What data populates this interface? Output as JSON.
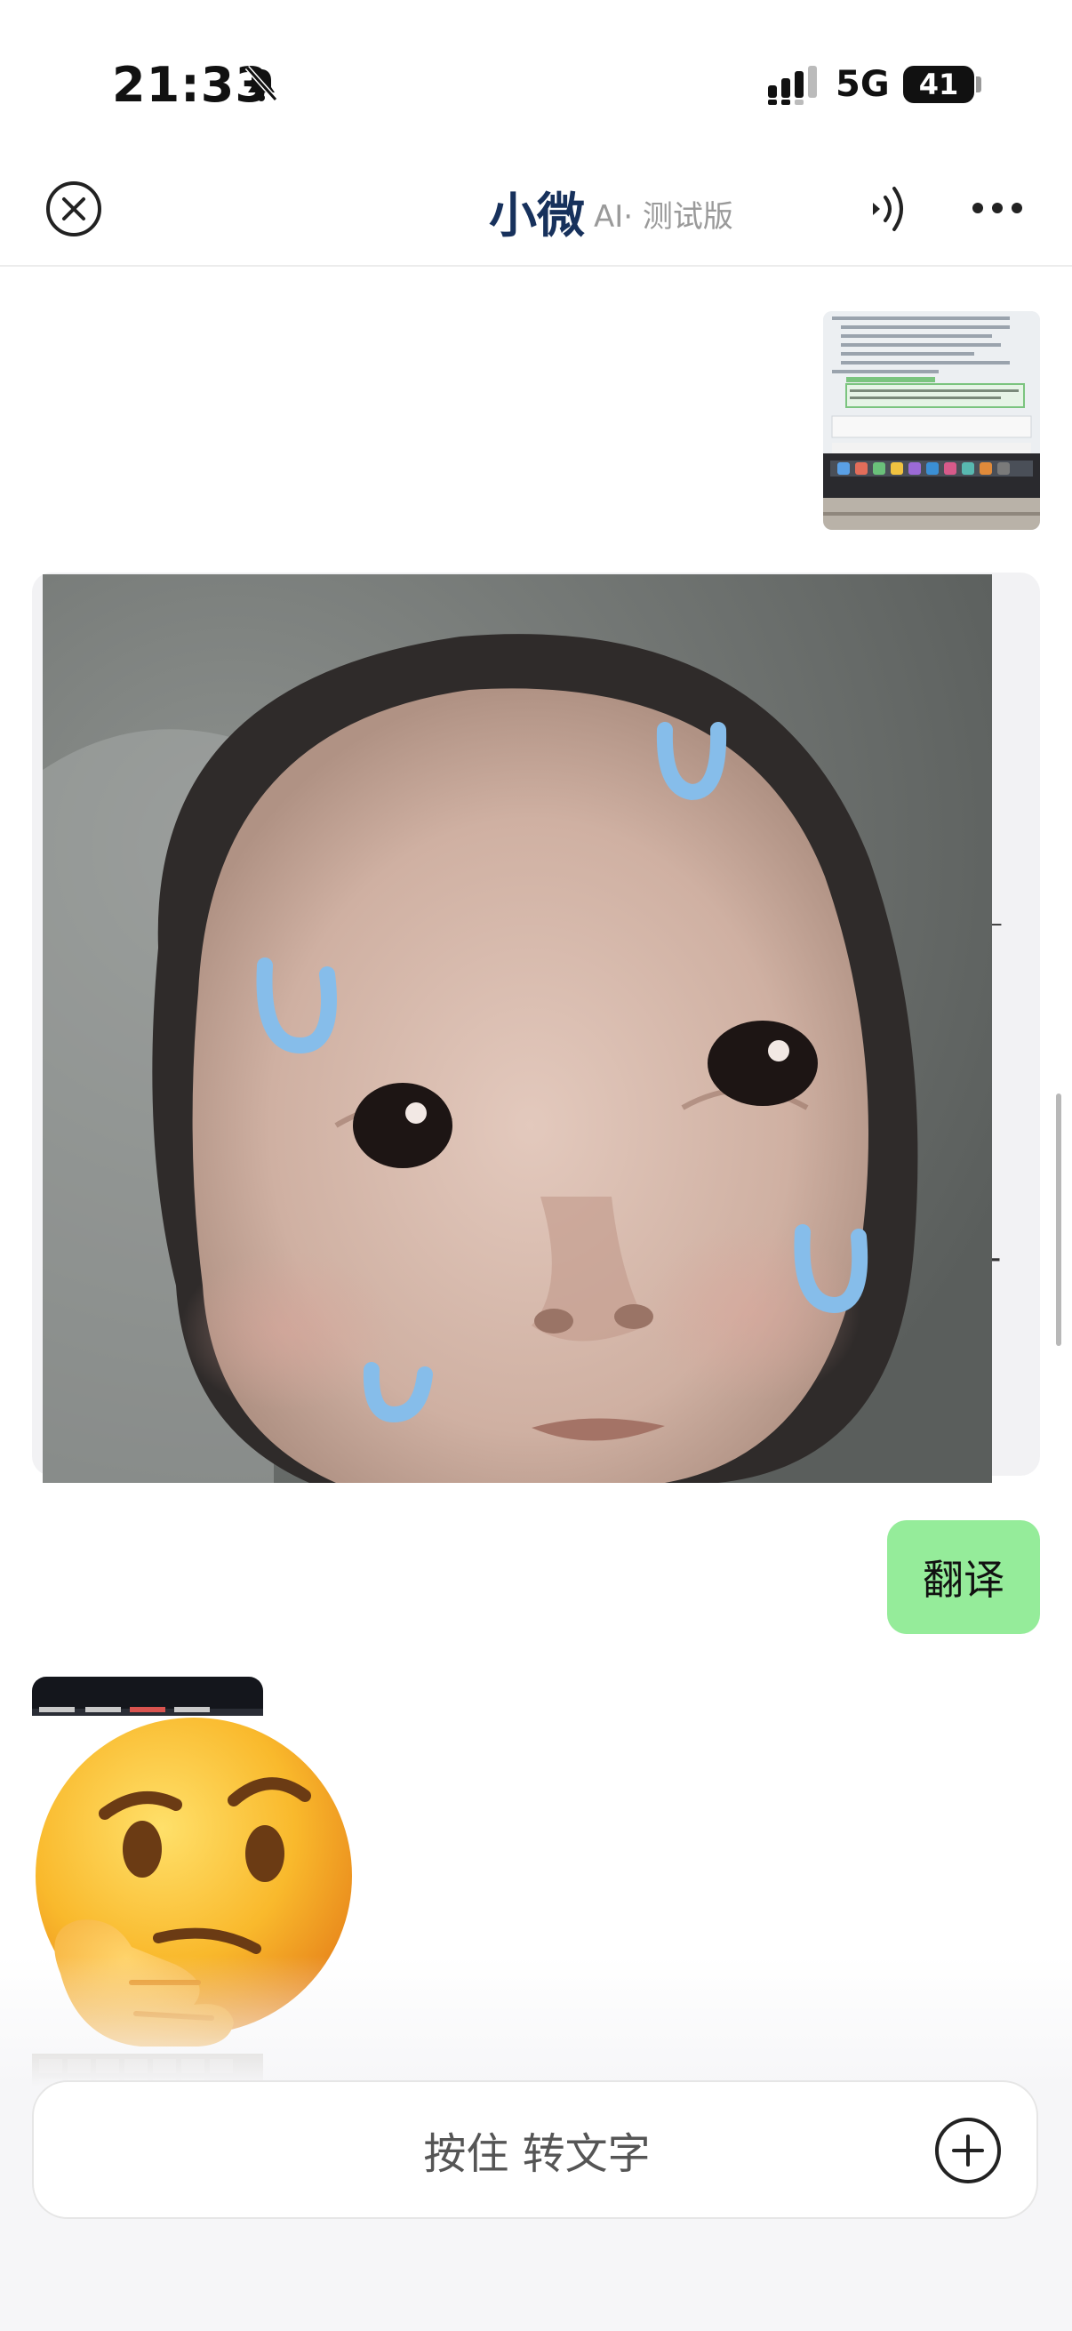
{
  "status_bar": {
    "time": "21:33",
    "network": "5G",
    "battery": "41"
  },
  "nav": {
    "title": "小微",
    "subtitle": "AI· 测试版"
  },
  "messages": {
    "user_text": "翻译"
  },
  "input_bar": {
    "hold_to_talk_label": "按住 转文字"
  },
  "icons": {
    "close": "close-circle-icon",
    "voice": "voice-wave-icon",
    "more": "more-dots-icon",
    "add": "plus-circle-icon",
    "silent": "bell-off-icon",
    "signal": "cellular-signal-icon",
    "emoji": "thinking-face-emoji"
  },
  "colors": {
    "title": "#17315c",
    "user_bubble": "#95ec9a",
    "bot_bubble": "#f2f2f4"
  }
}
